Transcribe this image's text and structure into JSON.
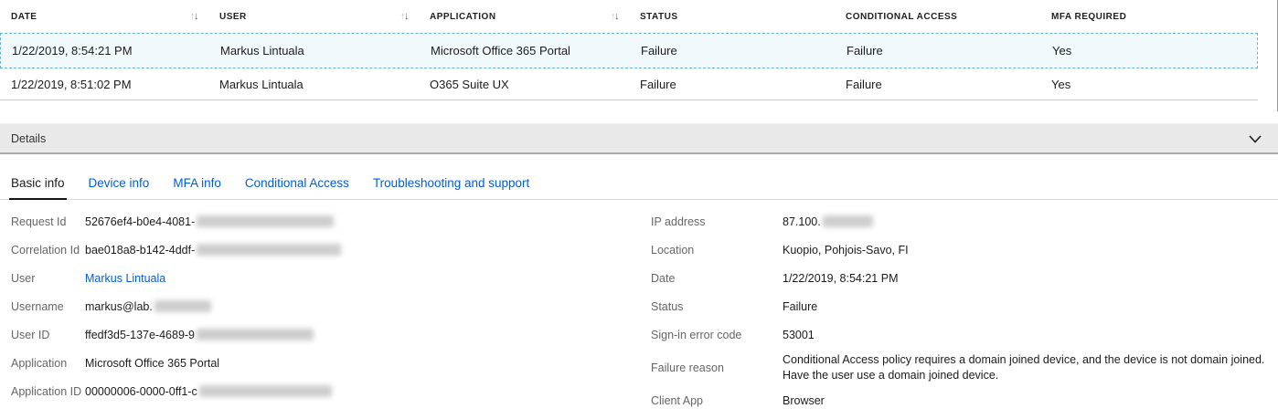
{
  "colors": {
    "accent_blue": "#015cda",
    "selection_bg": "#f2f9fd",
    "selection_border": "#69b2de",
    "details_bar_bg": "#e9e9e9"
  },
  "icons": {
    "sort_up": "↑",
    "sort_down": "↓",
    "chevron_down": "chevron-down"
  },
  "table": {
    "columns": [
      "DATE",
      "USER",
      "APPLICATION",
      "STATUS",
      "CONDITIONAL ACCESS",
      "MFA REQUIRED"
    ],
    "rows": [
      {
        "date": "1/22/2019, 8:54:21 PM",
        "user": "Markus Lintuala",
        "application": "Microsoft Office 365 Portal",
        "status": "Failure",
        "conditional_access": "Failure",
        "mfa_required": "Yes"
      },
      {
        "date": "1/22/2019, 8:51:02 PM",
        "user": "Markus Lintuala",
        "application": "O365 Suite UX",
        "status": "Failure",
        "conditional_access": "Failure",
        "mfa_required": "Yes"
      }
    ]
  },
  "details_bar": {
    "label": "Details"
  },
  "tabs": [
    "Basic info",
    "Device info",
    "MFA info",
    "Conditional Access",
    "Troubleshooting and support"
  ],
  "basic_info": {
    "left": [
      {
        "label": "Request Id",
        "value": "52676ef4-b0e4-4081-",
        "redacted": true
      },
      {
        "label": "Correlation Id",
        "value": "bae018a8-b142-4ddf-",
        "redacted": true
      },
      {
        "label": "User",
        "value": "Markus Lintuala",
        "link": true
      },
      {
        "label": "Username",
        "value": "markus@lab.",
        "redacted": true
      },
      {
        "label": "User ID",
        "value": "ffedf3d5-137e-4689-9",
        "redacted": true
      },
      {
        "label": "Application",
        "value": "Microsoft Office 365 Portal"
      },
      {
        "label": "Application ID",
        "value": "00000006-0000-0ff1-c",
        "redacted": true
      }
    ],
    "right": [
      {
        "label": "IP address",
        "value": "87.100.",
        "redacted": true
      },
      {
        "label": "Location",
        "value": "Kuopio, Pohjois-Savo, FI"
      },
      {
        "label": "Date",
        "value": "1/22/2019, 8:54:21 PM"
      },
      {
        "label": "Status",
        "value": "Failure"
      },
      {
        "label": "Sign-in error code",
        "value": "53001"
      },
      {
        "label": "Failure reason",
        "value": "Conditional Access policy requires a domain joined device, and the device is not domain joined. Have the user use a domain joined device."
      },
      {
        "label": "Client App",
        "value": "Browser"
      }
    ]
  }
}
